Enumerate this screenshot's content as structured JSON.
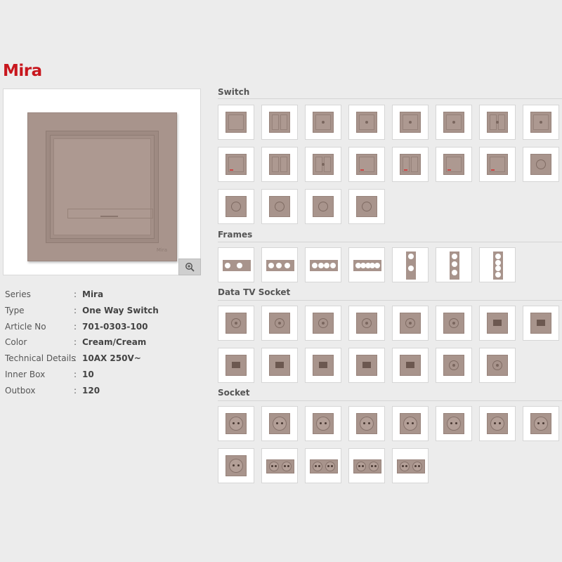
{
  "page": {
    "title": "Mira"
  },
  "product": {
    "brand_mark": "Mira",
    "zoom_icon": "zoom-in-icon",
    "plate_color": "#a8948c"
  },
  "specs": [
    {
      "label": "Series",
      "value": "Mira"
    },
    {
      "label": "Type",
      "value": "One Way Switch"
    },
    {
      "label": "Article No",
      "value": "701-0303-100"
    },
    {
      "label": "Color",
      "value": "Cream/Cream"
    },
    {
      "label": "Technical Details",
      "value": "10AX 250V~"
    },
    {
      "label": "Inner Box",
      "value": "10"
    },
    {
      "label": "Outbox",
      "value": "120"
    }
  ],
  "sections": {
    "switch": {
      "title": "Switch",
      "items": [
        "single",
        "double",
        "single-dot",
        "single-dot",
        "single-dot",
        "single-dot",
        "double-dot",
        "single-dot",
        "single-red",
        "double",
        "double-dot",
        "single-red",
        "double-red",
        "single-red",
        "single-red",
        "ring",
        "ring",
        "ring",
        "dimmer",
        "ring"
      ]
    },
    "frames": {
      "title": "Frames",
      "items": [
        "h2",
        "h3",
        "h4",
        "h5",
        "v2",
        "v3",
        "v4"
      ]
    },
    "data_tv": {
      "title": "Data TV Socket",
      "items": [
        "tv",
        "tv",
        "tv2",
        "tv2",
        "tv3",
        "tv3",
        "jack",
        "jack2",
        "jack",
        "jack2",
        "jack2",
        "jack2",
        "jack2",
        "tv3b",
        "tv3b"
      ]
    },
    "socket": {
      "title": "Socket",
      "items": [
        "sock",
        "sock",
        "sock",
        "sock",
        "sock-lid",
        "sock-lid",
        "sock",
        "sock",
        "sock",
        "sock2",
        "sock2",
        "sock2",
        "sock2"
      ]
    }
  }
}
